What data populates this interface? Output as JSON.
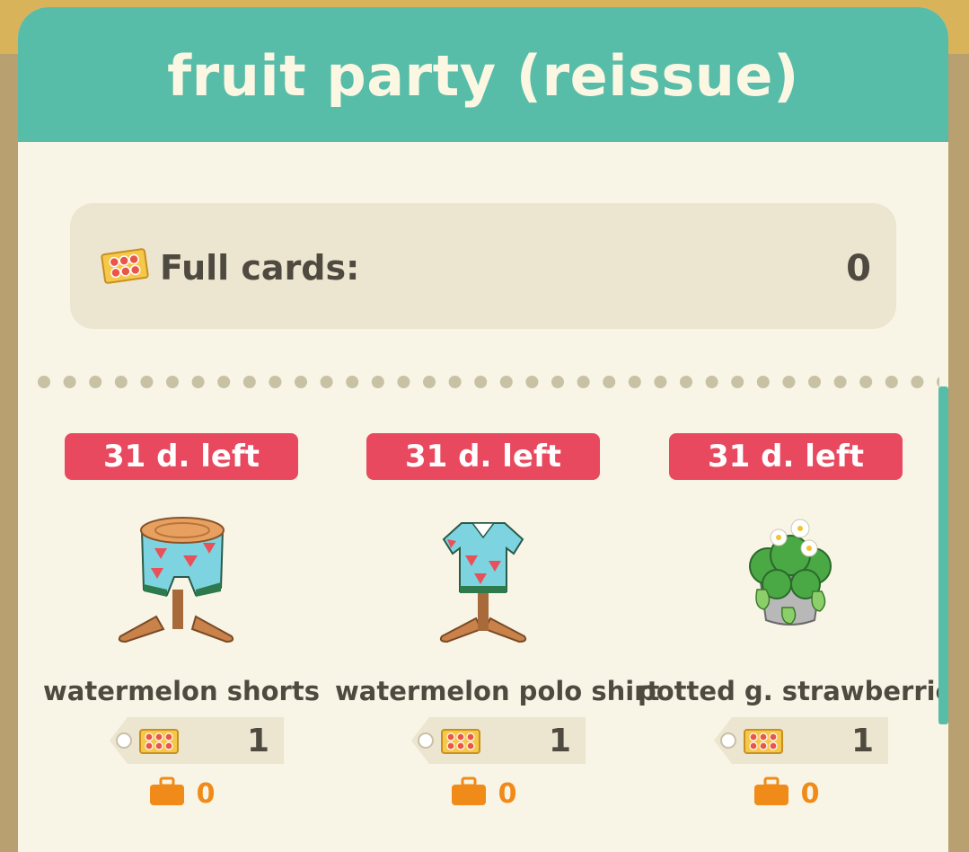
{
  "header": {
    "title": "fruit party (reissue)"
  },
  "summary": {
    "label": "Full cards:",
    "value": "0",
    "icon": "stamp-card-icon"
  },
  "items": [
    {
      "time_left": "31 d. left",
      "name": "watermelon shorts",
      "cost": "1",
      "owned": "0",
      "image": "watermelon-shorts-icon"
    },
    {
      "time_left": "31 d. left",
      "name": "watermelon polo shirt",
      "cost": "1",
      "owned": "0",
      "image": "watermelon-polo-shirt-icon"
    },
    {
      "time_left": "31 d. left",
      "name": "potted g. strawberries",
      "cost": "1",
      "owned": "0",
      "image": "potted-strawberries-icon"
    }
  ],
  "colors": {
    "header": "#57bca8",
    "panel": "#f8f5e6",
    "badge": "#e8495f",
    "owned": "#f08a18",
    "text": "#4e4a40"
  }
}
